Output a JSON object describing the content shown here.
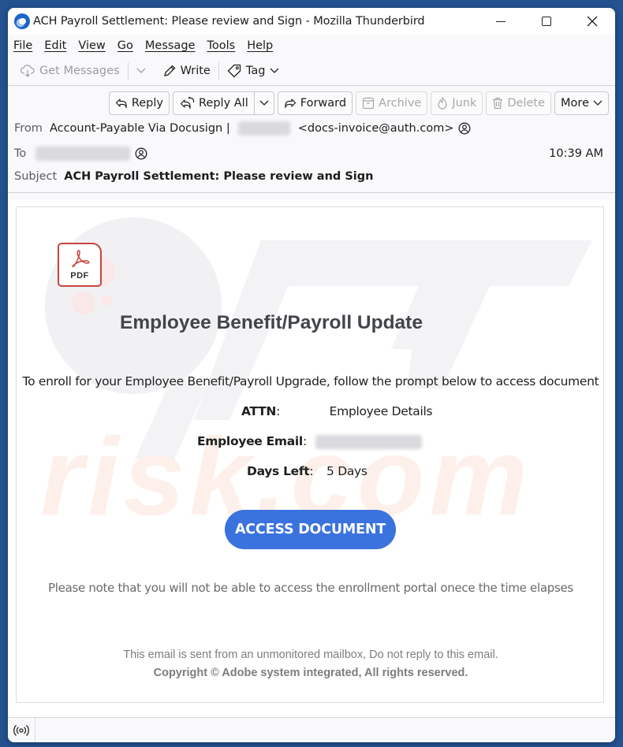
{
  "window": {
    "title": "ACH Payroll Settlement: Please review and Sign - Mozilla Thunderbird",
    "controls": {
      "minimize": "minimize",
      "maximize": "maximize",
      "close": "×"
    }
  },
  "menubar": {
    "items": [
      "File",
      "Edit",
      "View",
      "Go",
      "Message",
      "Tools",
      "Help"
    ]
  },
  "toolbar": {
    "get_messages": "Get Messages",
    "write": "Write",
    "tag": "Tag"
  },
  "actions": {
    "reply": "Reply",
    "reply_all": "Reply All",
    "forward": "Forward",
    "archive": "Archive",
    "junk": "Junk",
    "delete": "Delete",
    "more": "More"
  },
  "header": {
    "from_label": "From",
    "from_name": "Account-Payable Via Docusign |",
    "from_email": "<docs-invoice@auth.com>",
    "to_label": "To",
    "date": "10:39 AM",
    "subject_label": "Subject",
    "subject": "ACH Payroll Settlement: Please review and Sign"
  },
  "email": {
    "pdf_label": "PDF",
    "title": "Employee Benefit/Payroll Update",
    "intro": "To enroll for your Employee Benefit/Payroll Upgrade, follow the prompt below to access document",
    "attn_label": "ATTN",
    "attn_value": "Employee Details",
    "email_label": "Employee Email",
    "days_label": "Days Left",
    "days_value": "5 Days",
    "button": "ACCESS DOCUMENT",
    "note": "Please note that you will not be able to access the enrollment portal onece the time elapses",
    "footer_line1": "This email is sent from an unmonitored mailbox, Do not reply to this email.",
    "footer_line2": "Copyright © Adobe system integrated, All rights reserved.",
    "button_color": "#3a72de"
  },
  "statusbar": {
    "icon": "online-status-icon"
  }
}
